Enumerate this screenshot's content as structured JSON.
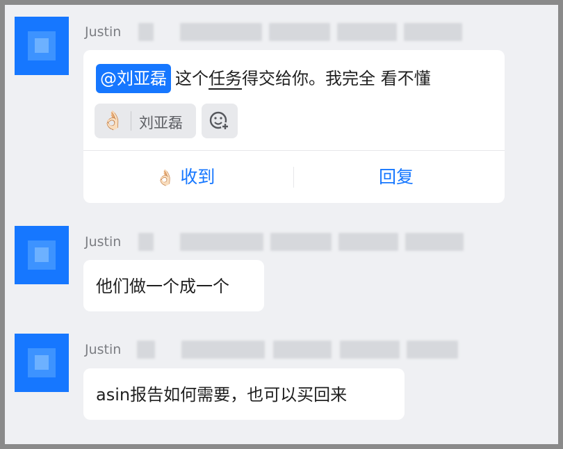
{
  "messages": [
    {
      "sender": "Justin",
      "mention": "@刘亚磊",
      "text_before": "这个",
      "text_underlined": "任务",
      "text_after": "得交给你。我完全 看不懂",
      "reaction": {
        "emoji": "👌🏻",
        "user": "刘亚磊"
      },
      "actions": {
        "ack_emoji": "👌🏻",
        "ack_label": "收到",
        "reply_label": "回复"
      }
    },
    {
      "sender": "Justin",
      "text": "他们做一个成一个"
    },
    {
      "sender": "Justin",
      "text": "asin报告如何需要，也可以买回来"
    }
  ],
  "icons": {
    "avatar": "avatar-image",
    "add_reaction": "emoji-add-icon"
  },
  "colors": {
    "accent": "#1677ff",
    "bubble": "#ffffff",
    "background": "#eff0f3"
  }
}
